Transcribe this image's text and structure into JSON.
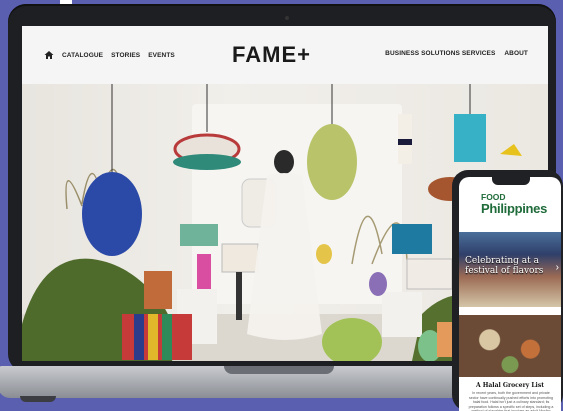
{
  "header": {
    "nav_left": [
      "CATALOGUE",
      "STORIES",
      "EVENTS"
    ],
    "logo": "FAME+",
    "nav_right": [
      "BUSINESS SOLUTIONS SERVICES",
      "ABOUT"
    ]
  },
  "mobile": {
    "brand_top": "FOOD",
    "brand_bottom": "Philippines",
    "hero_headline": "Celebrating at a festival of flavors",
    "article_title": "A Halal Grocery List",
    "article_excerpt": "In recent years, both the government and private sector have continually pushed efforts into promoting halal food. Halal isn't just a culinary standard; its preparation follows a specific set of steps, including a method of slaughter that involves an adult Muslim"
  },
  "colors": {
    "background": "#5a5fb0",
    "brand_green": "#1f6b3a"
  }
}
